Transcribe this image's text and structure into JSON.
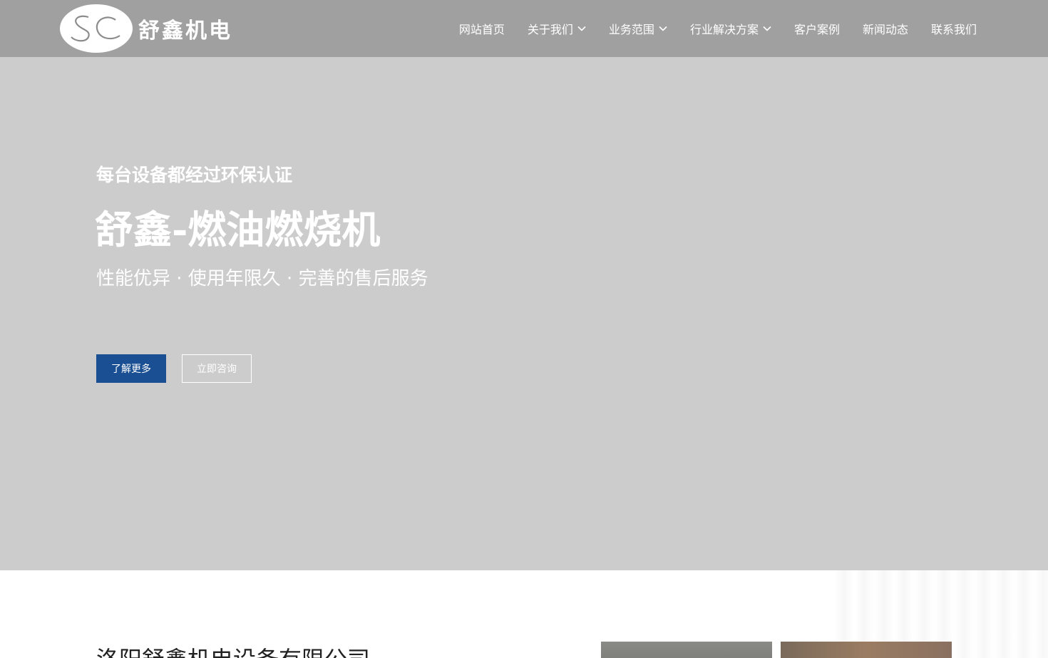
{
  "header": {
    "logo_text": "舒鑫机电",
    "logo_mark_text": "SC",
    "nav": [
      {
        "label": "网站首页",
        "has_dropdown": false
      },
      {
        "label": "关于我们",
        "has_dropdown": true
      },
      {
        "label": "业务范围",
        "has_dropdown": true
      },
      {
        "label": "行业解决方案",
        "has_dropdown": true
      },
      {
        "label": "客户案例",
        "has_dropdown": false
      },
      {
        "label": "新闻动态",
        "has_dropdown": false
      },
      {
        "label": "联系我们",
        "has_dropdown": false
      }
    ]
  },
  "hero": {
    "tagline": "每台设备都经过环保认证",
    "title": "舒鑫-燃油燃烧机",
    "subtitle": "性能优异 · 使用年限久 · 完善的售后服务",
    "primary_button": "了解更多",
    "secondary_button": "立即咨询"
  },
  "about": {
    "company_name": "洛阳舒鑫机电设备有限公司"
  },
  "colors": {
    "header_bg": "#a0a0a0",
    "hero_bg": "#cccccc",
    "primary_button": "#1a4f93"
  }
}
